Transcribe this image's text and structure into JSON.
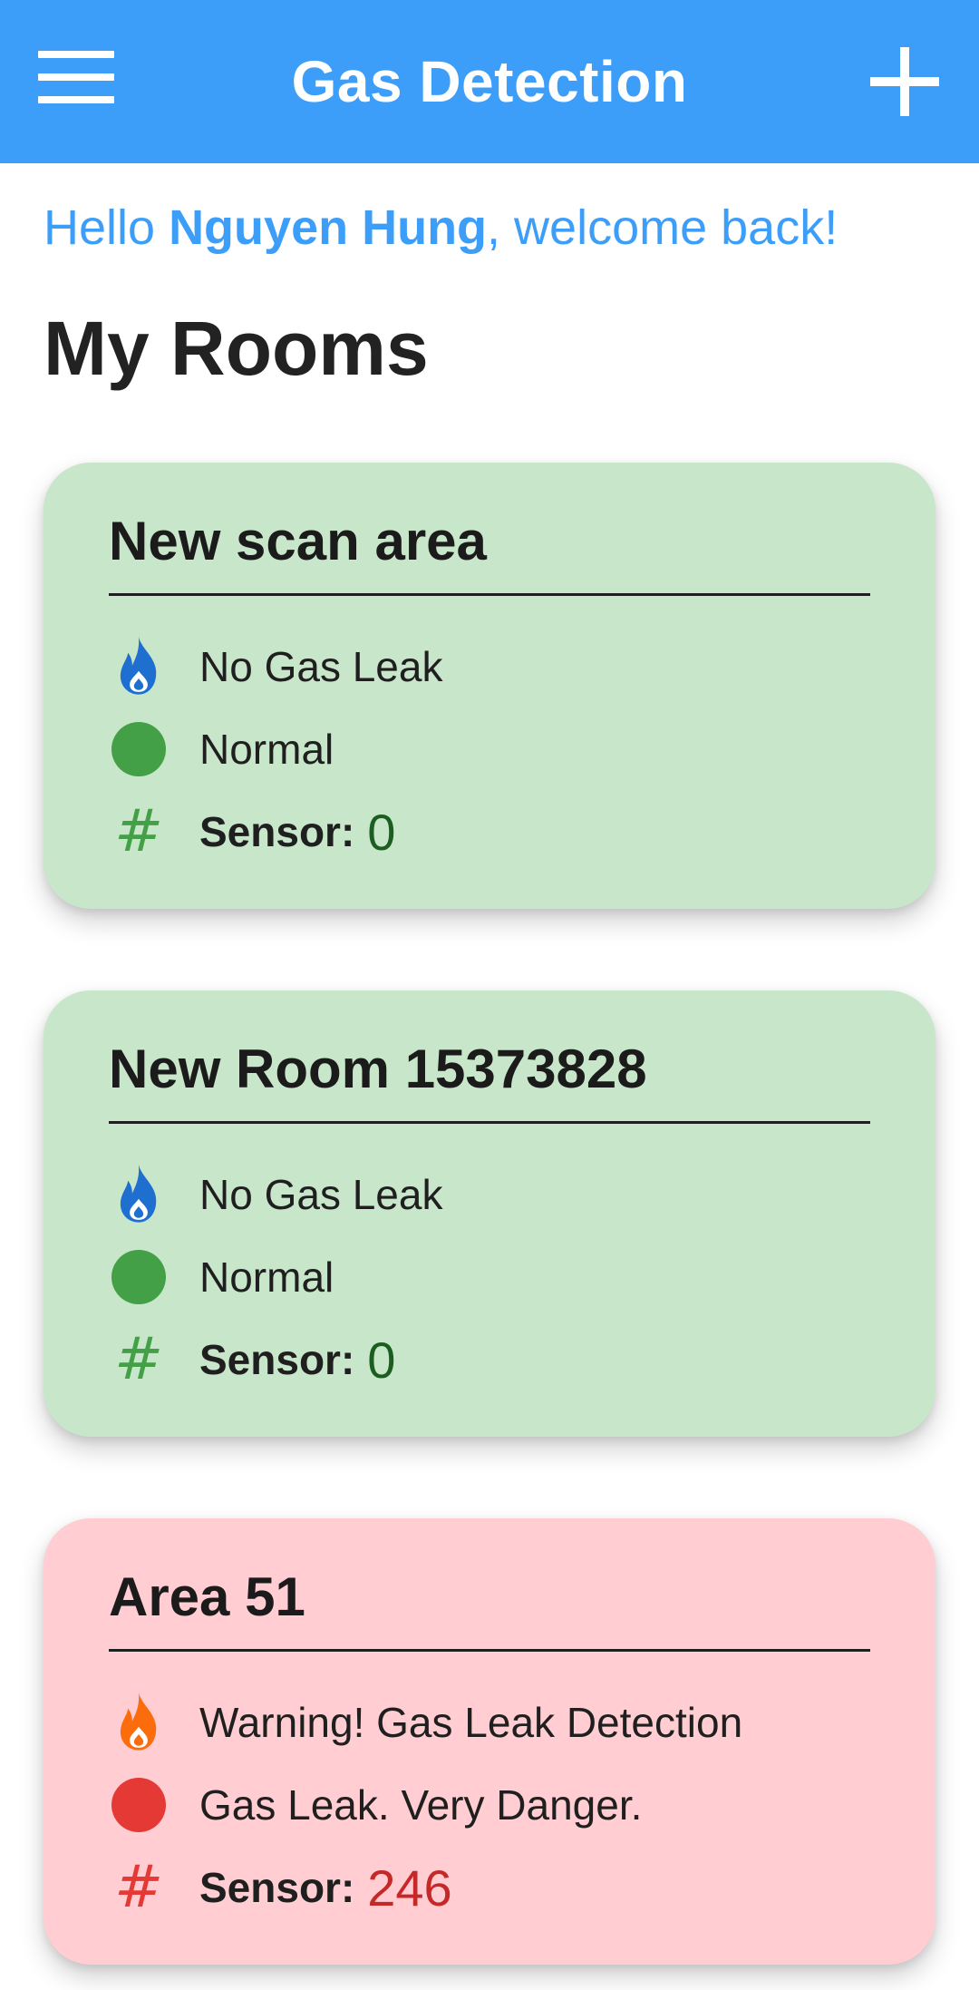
{
  "app_bar": {
    "title": "Gas Detection"
  },
  "greeting": {
    "prefix": "Hello ",
    "user_name": "Nguyen Hung",
    "suffix": ", welcome back!"
  },
  "section_title": "My Rooms",
  "colors": {
    "primary": "#3d9ef9",
    "safe_bg": "#c8e6c9",
    "danger_bg": "#ffcdd2",
    "safe_dot": "#43a047",
    "danger_dot": "#e53935",
    "safe_value": "#1b5e20",
    "danger_value": "#c62828",
    "flame_safe": "#1e6fd0",
    "flame_danger": "#fb6d0c"
  },
  "rooms": [
    {
      "name": "New scan area",
      "gas_status": "No Gas Leak",
      "level_status": "Normal",
      "sensor_label": "Sensor:",
      "sensor_value": "0",
      "state": "safe"
    },
    {
      "name": "New Room 15373828",
      "gas_status": "No Gas Leak",
      "level_status": "Normal",
      "sensor_label": "Sensor:",
      "sensor_value": "0",
      "state": "safe"
    },
    {
      "name": "Area 51",
      "gas_status": "Warning! Gas Leak Detection",
      "level_status": "Gas Leak. Very Danger.",
      "sensor_label": "Sensor:",
      "sensor_value": "246",
      "state": "danger"
    }
  ]
}
